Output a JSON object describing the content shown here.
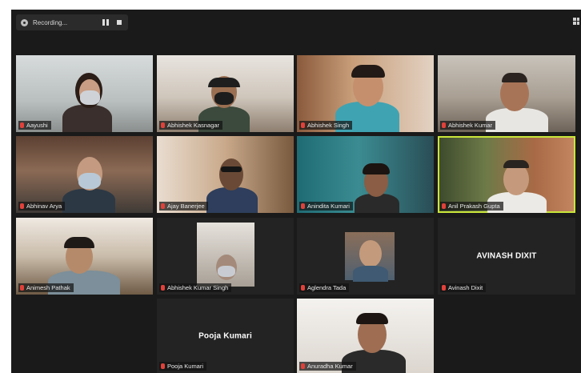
{
  "recording": {
    "label": "Recording..."
  },
  "participants": [
    {
      "name": "Aayushi"
    },
    {
      "name": "Abhishek Kasnagar"
    },
    {
      "name": "Abhishek Singh"
    },
    {
      "name": "Abhishek Kumar"
    },
    {
      "name": "Abhinav Arya"
    },
    {
      "name": "Ajay Banerjee"
    },
    {
      "name": "Anindita Kumari"
    },
    {
      "name": "Anil Prakash Gupta"
    },
    {
      "name": "Animesh Pathak"
    },
    {
      "name": "Abhishek Kumar Singh"
    },
    {
      "name": "Aglendra Tada"
    },
    {
      "name": "Avinash Dixit"
    },
    {
      "name": "Pooja Kumari"
    },
    {
      "name": "Anuradha Kumar"
    }
  ],
  "video_off_tiles": {
    "avinash_big": "AVINASH DIXIT",
    "pooja_big": "Pooja Kumari"
  },
  "colors": {
    "active_speaker_border": "#c9e63a",
    "muted_mic": "#e0413a",
    "background": "#1a1a1a"
  }
}
